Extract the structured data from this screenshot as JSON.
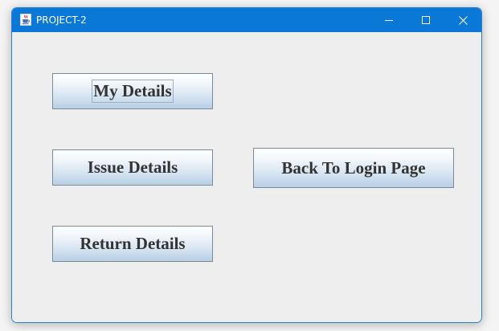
{
  "window": {
    "title": "PROJECT-2",
    "app_icon": "java-coffee-cup-icon",
    "accent_color": "#0a78d7",
    "controls": {
      "minimize_icon": "minimize-icon",
      "maximize_icon": "maximize-icon",
      "close_icon": "close-icon"
    }
  },
  "buttons": {
    "my_details": "My Details",
    "issue_details": "Issue Details",
    "return_details": "Return Details",
    "back_to_login": "Back To Login Page",
    "focused": "my_details"
  }
}
